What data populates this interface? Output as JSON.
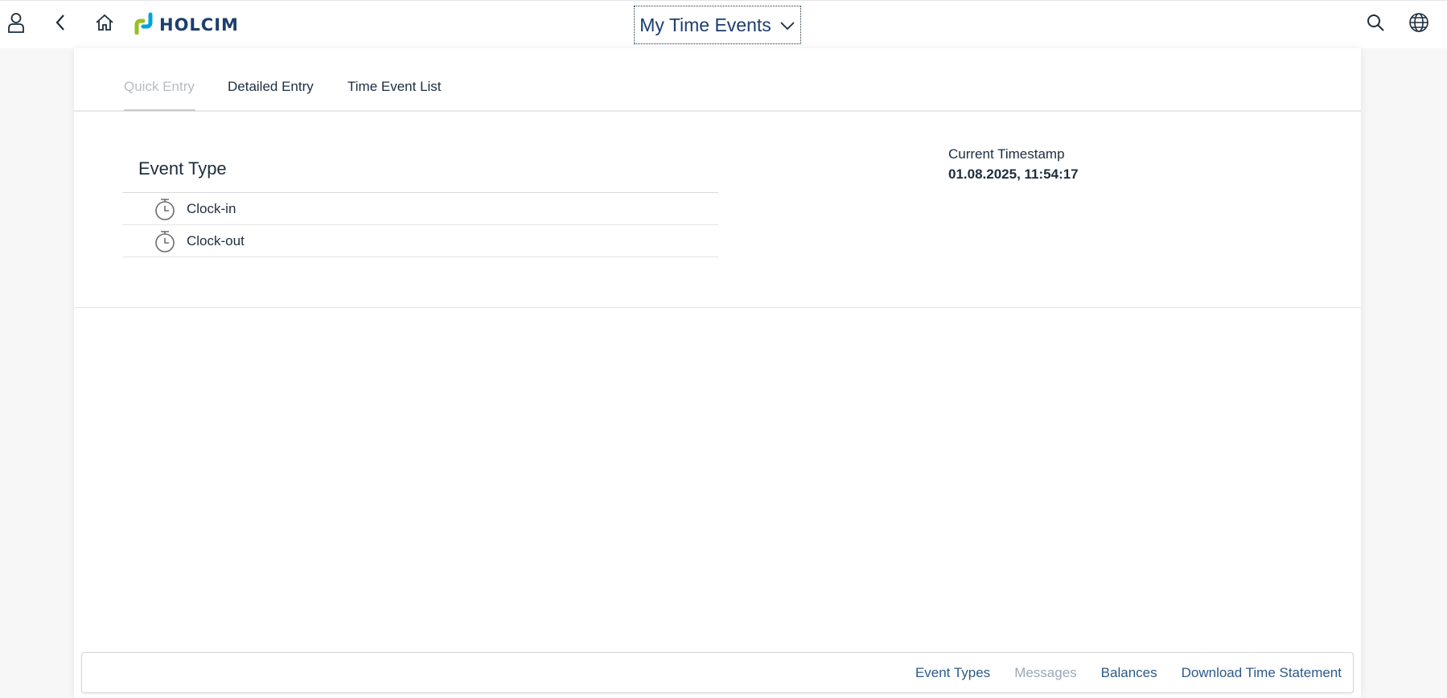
{
  "header": {
    "title": "My Time Events",
    "logo_text": "HOLCIM",
    "icons": {
      "profile": "user-icon",
      "back": "back-arrow-icon",
      "home": "home-icon",
      "title_menu": "chevron-down-icon",
      "search": "search-icon",
      "language": "globe-icon"
    }
  },
  "tabs": [
    {
      "label": "Quick Entry",
      "selected": true
    },
    {
      "label": "Detailed Entry",
      "selected": false
    },
    {
      "label": "Time Event List",
      "selected": false
    }
  ],
  "quick_entry": {
    "heading": "Event Type",
    "events": [
      {
        "label": "Clock-in",
        "icon": "stopwatch-icon"
      },
      {
        "label": "Clock-out",
        "icon": "stopwatch-icon"
      }
    ],
    "timestamp_label": "Current Timestamp",
    "timestamp_value": "01.08.2025, 11:54:17"
  },
  "footer": {
    "buttons": [
      {
        "label": "Event Types",
        "enabled": true
      },
      {
        "label": "Messages",
        "enabled": false
      },
      {
        "label": "Balances",
        "enabled": true
      },
      {
        "label": "Download Time Statement",
        "enabled": true
      }
    ]
  },
  "colors": {
    "brand_blue": "#1d3d6e",
    "brand_green": "#95c11f",
    "brand_teal": "#00a3e0",
    "link": "#2b5a8a"
  }
}
